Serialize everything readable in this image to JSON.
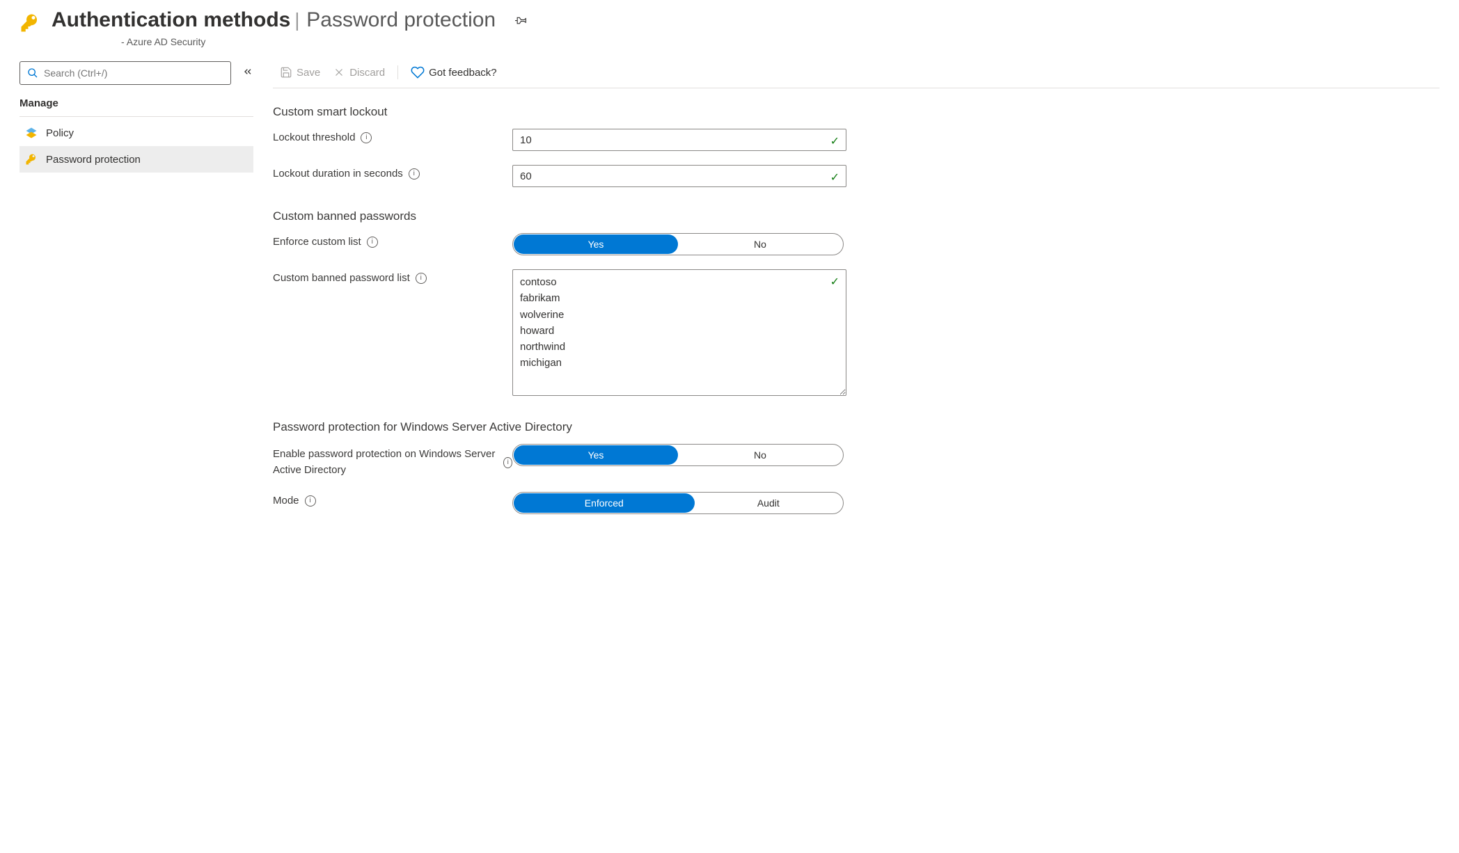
{
  "header": {
    "title": "Authentication methods",
    "subtitle": "Password protection",
    "breadcrumb": "- Azure AD Security"
  },
  "search": {
    "placeholder": "Search (Ctrl+/)"
  },
  "sidebar": {
    "section": "Manage",
    "items": [
      {
        "label": "Policy"
      },
      {
        "label": "Password protection"
      }
    ]
  },
  "toolbar": {
    "save": "Save",
    "discard": "Discard",
    "feedback": "Got feedback?"
  },
  "sections": {
    "lockout": {
      "title": "Custom smart lockout",
      "threshold_label": "Lockout threshold",
      "threshold_value": "10",
      "duration_label": "Lockout duration in seconds",
      "duration_value": "60"
    },
    "banned": {
      "title": "Custom banned passwords",
      "enforce_label": "Enforce custom list",
      "enforce_yes": "Yes",
      "enforce_no": "No",
      "list_label": "Custom banned password list",
      "list_value": "contoso\nfabrikam\nwolverine\nhoward\nnorthwind\nmichigan"
    },
    "winserver": {
      "title": "Password protection for Windows Server Active Directory",
      "enable_label": "Enable password protection on Windows Server Active Directory",
      "enable_yes": "Yes",
      "enable_no": "No",
      "mode_label": "Mode",
      "mode_enforced": "Enforced",
      "mode_audit": "Audit"
    }
  }
}
